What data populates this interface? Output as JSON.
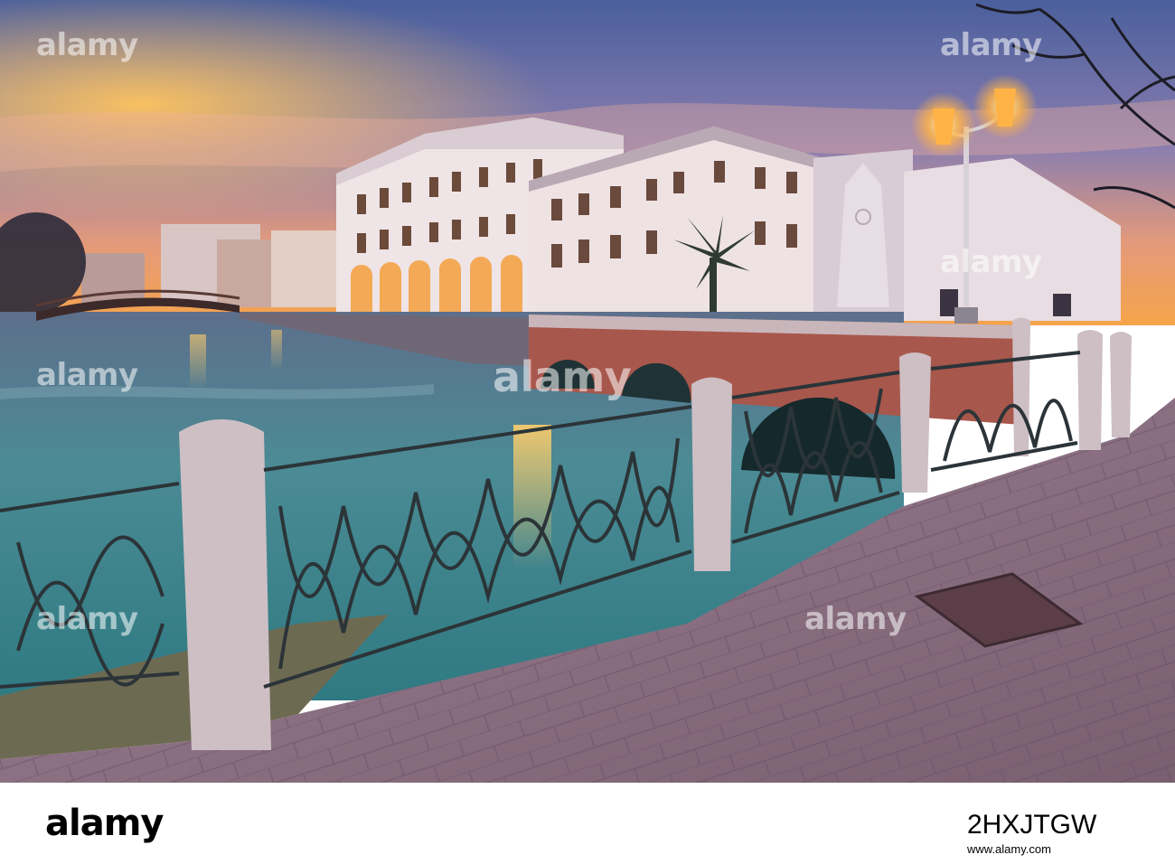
{
  "photo": {
    "subject": "Illuminated palazzi and a brick arched bridge along a river canal at sunset, with an iron railing, stone bollards and a double street lamp on a paved walkway",
    "colors": {
      "sky_top": "#4a5f9c",
      "sky_glow": "#f29a4a",
      "water": "#3f8f94",
      "pavement": "#8a6f80",
      "building": "#f1e6e3",
      "brick": "#a8574c",
      "lamp_glow": "#ffb347"
    }
  },
  "watermark": {
    "text": "alamy"
  },
  "footer": {
    "logo": "alamy",
    "image_id": "2HXJTGW",
    "url": "www.alamy.com"
  }
}
